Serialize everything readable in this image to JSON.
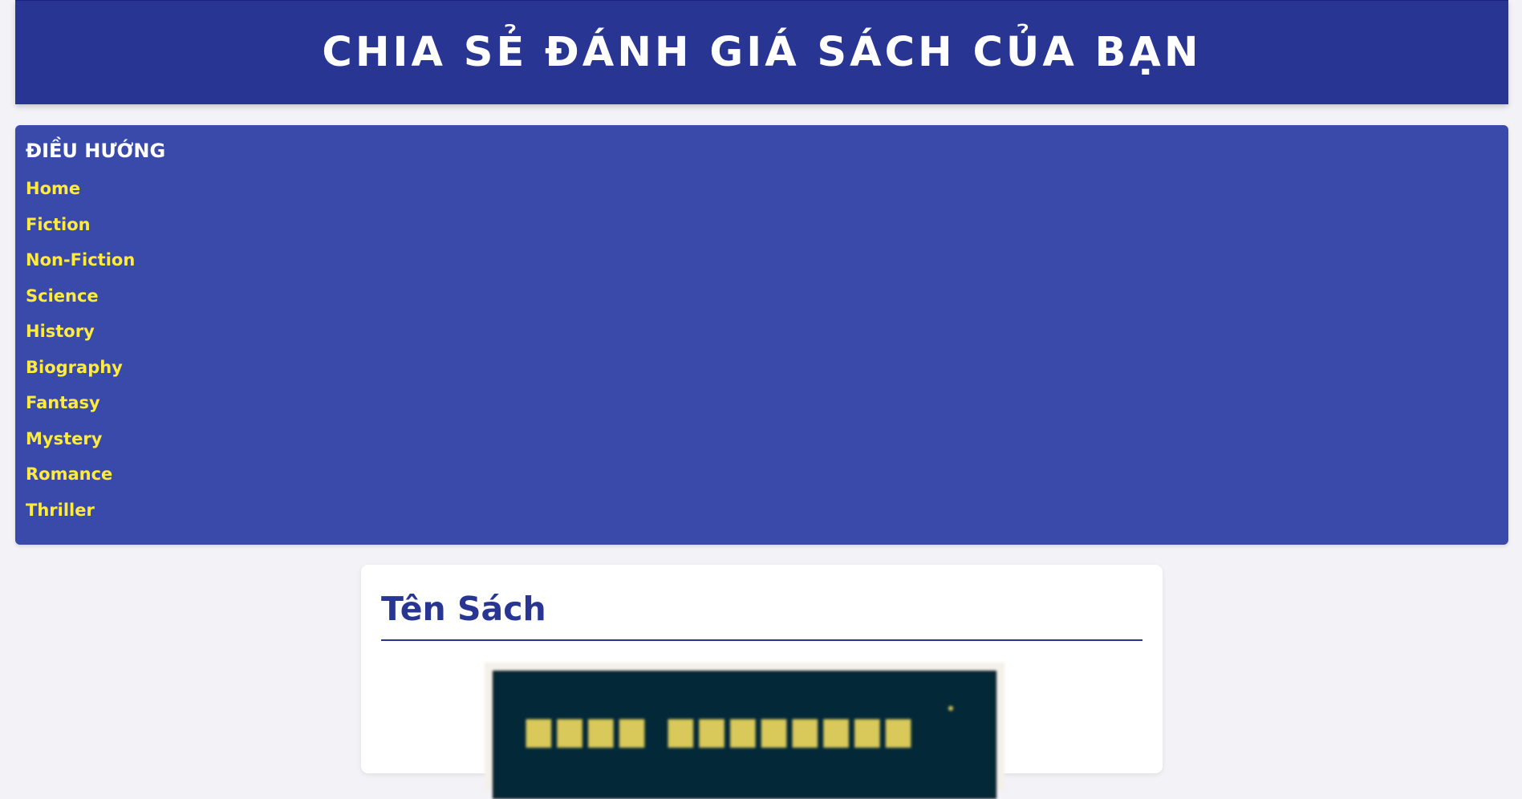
{
  "header": {
    "title": "CHIA SẺ ĐÁNH GIÁ SÁCH CỦA BẠN"
  },
  "nav": {
    "title": "ĐIỀU HƯỚNG",
    "items": [
      {
        "label": "Home"
      },
      {
        "label": "Fiction"
      },
      {
        "label": "Non-Fiction"
      },
      {
        "label": "Science"
      },
      {
        "label": "History"
      },
      {
        "label": "Biography"
      },
      {
        "label": "Fantasy"
      },
      {
        "label": "Mystery"
      },
      {
        "label": "Romance"
      },
      {
        "label": "Thriller"
      }
    ]
  },
  "book": {
    "title": "Tên Sách"
  },
  "colors": {
    "header_bg": "#283593",
    "nav_bg": "#3a4aab",
    "nav_link": "#ffeb3b",
    "page_bg": "#f3f2f7",
    "card_bg": "#ffffff",
    "title_color": "#283593",
    "cover_bg": "#032837"
  }
}
